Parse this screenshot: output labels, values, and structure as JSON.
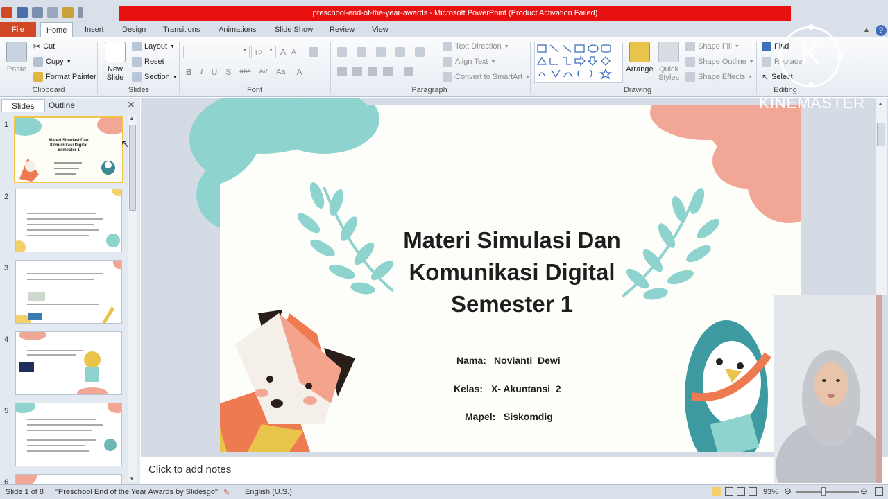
{
  "window": {
    "title": "preschool-end-of-the-year-awards  -  Microsoft PowerPoint (Product Activation Failed)"
  },
  "ribbon_tabs": [
    "File",
    "Home",
    "Insert",
    "Design",
    "Transitions",
    "Animations",
    "Slide Show",
    "Review",
    "View"
  ],
  "active_tab": "Home",
  "clipboard": {
    "paste": "Paste",
    "cut": "Cut",
    "copy": "Copy",
    "format_painter": "Format Painter",
    "group_label": "Clipboard"
  },
  "slides_group": {
    "new_slide_line1": "New",
    "new_slide_line2": "Slide",
    "layout": "Layout",
    "reset": "Reset",
    "section": "Section",
    "group_label": "Slides"
  },
  "font_group": {
    "font_name": "",
    "font_size": "12",
    "group_label": "Font"
  },
  "paragraph_group": {
    "text_direction": "Text Direction",
    "align_text": "Align Text",
    "convert_smartart": "Convert to SmartArt",
    "group_label": "Paragraph"
  },
  "drawing_group": {
    "arrange": "Arrange",
    "quick_styles_line1": "Quick",
    "quick_styles_line2": "Styles",
    "shape_fill": "Shape Fill",
    "shape_outline": "Shape Outline",
    "shape_effects": "Shape Effects",
    "group_label": "Drawing"
  },
  "editing_group": {
    "find": "Find",
    "replace": "Replace",
    "select": "Select",
    "group_label": "Editing"
  },
  "pane_tabs": {
    "slides": "Slides",
    "outline": "Outline"
  },
  "thumbnails": [
    {
      "num": "1",
      "title": "Materi Simulasi Dan Komunikasi Digital Semester 1",
      "selected": true
    },
    {
      "num": "2",
      "title": "",
      "selected": false
    },
    {
      "num": "3",
      "title": "",
      "selected": false
    },
    {
      "num": "4",
      "title": "",
      "selected": false
    },
    {
      "num": "5",
      "title": "",
      "selected": false
    },
    {
      "num": "6",
      "title": "",
      "selected": false
    }
  ],
  "slide": {
    "title_line1": "Materi Simulasi Dan",
    "title_line2": "Komunikasi Digital",
    "title_line3": "Semester 1",
    "nama_label": "Nama:",
    "nama_value": "Novianti  Dewi",
    "kelas_label": "Kelas:",
    "kelas_value": "X- Akuntansi  2",
    "mapel_label": "Mapel:",
    "mapel_value": "Siskomdig"
  },
  "notes_placeholder": "Click to add notes",
  "status": {
    "slide_count": "Slide 1 of 8",
    "theme": "\"Preschool End of the Year Awards by Slidesgo\"",
    "language": "English (U.S.)",
    "zoom": "93%"
  },
  "watermark": {
    "letter": "K",
    "text": "KINEMASTER"
  },
  "colors": {
    "accent_red": "#e8110f",
    "file_tab": "#d24726",
    "teal": "#8fd3cf",
    "salmon": "#f2a796",
    "fox": "#ee7a52"
  }
}
